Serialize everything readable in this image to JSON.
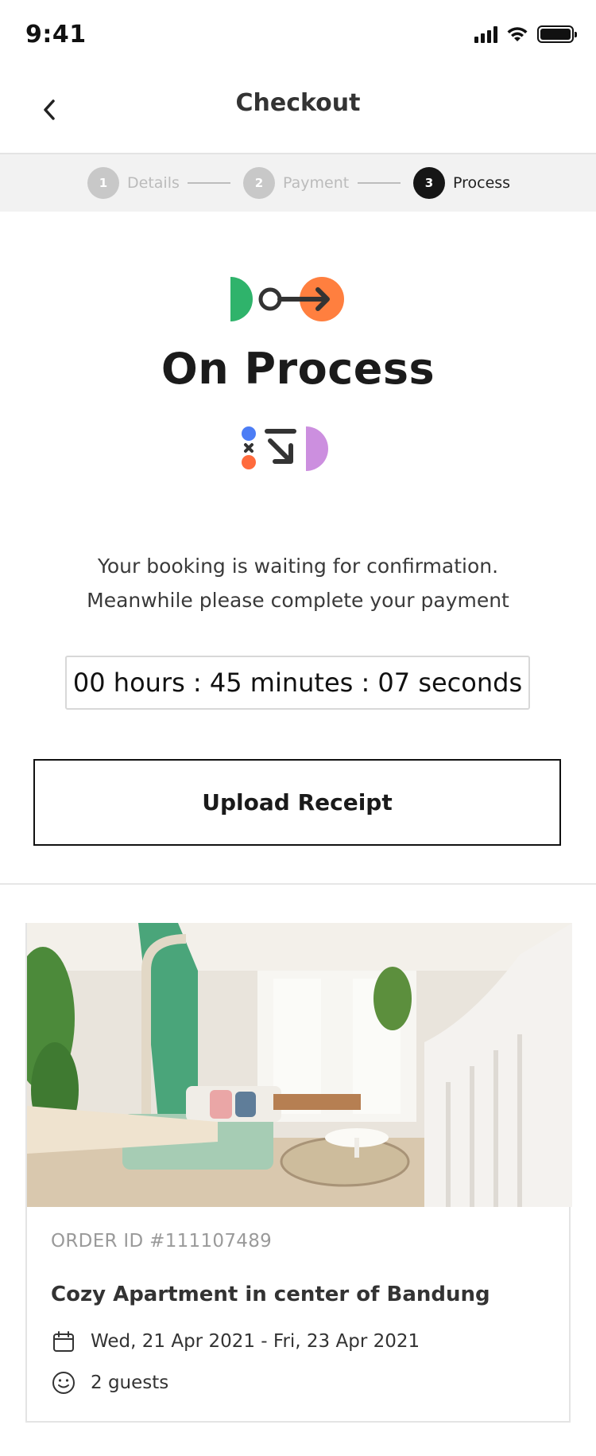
{
  "status_bar": {
    "time": "9:41"
  },
  "header": {
    "title": "Checkout"
  },
  "stepper": {
    "steps": [
      {
        "number": "1",
        "label": "Details"
      },
      {
        "number": "2",
        "label": "Payment"
      },
      {
        "number": "3",
        "label": "Process"
      }
    ],
    "active_step": 3
  },
  "process": {
    "title": "On Process",
    "message_line1": "Your booking is waiting for confirmation.",
    "message_line2": "Meanwhile please complete your payment",
    "countdown": "00 hours : 45 minutes : 07 seconds"
  },
  "actions": {
    "upload_label": "Upload Receipt"
  },
  "order": {
    "order_id": "ORDER ID #111107489",
    "property_name": "Cozy Apartment in center of Bandung",
    "dates": "Wed, 21 Apr 2021 - Fri, 23 Apr 2021",
    "guests": "2 guests",
    "date_icon": "calendar-icon",
    "guests_icon": "smiley-icon"
  },
  "colors": {
    "accent_green": "#2fb36b",
    "accent_orange": "#ff7f3f",
    "accent_blue": "#4c7df5",
    "accent_purple": "#cc8fdf",
    "step_active": "#161616",
    "step_inactive": "#c8c8c8"
  }
}
